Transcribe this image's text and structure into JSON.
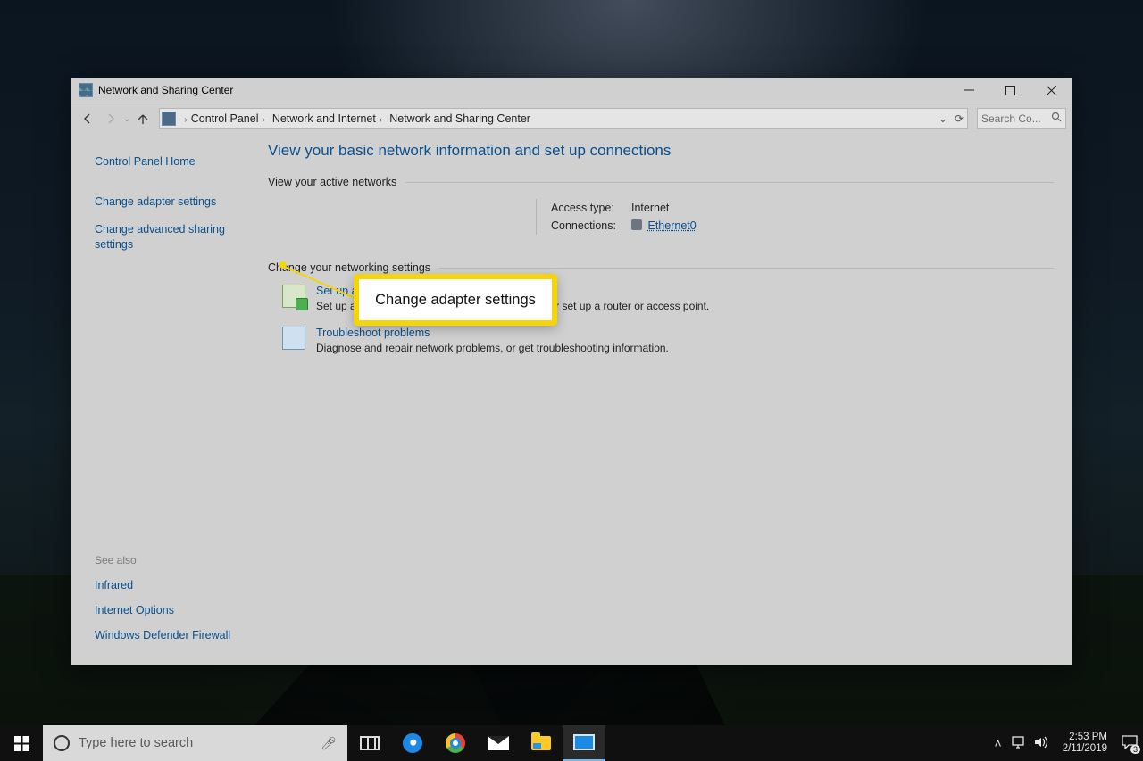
{
  "window": {
    "title": "Network and Sharing Center"
  },
  "breadcrumb": {
    "root": "Control Panel",
    "mid": "Network and Internet",
    "leaf": "Network and Sharing Center"
  },
  "search": {
    "placeholder": "Search Co..."
  },
  "sidebar": {
    "home": "Control Panel Home",
    "adapter": "Change adapter settings",
    "advanced": "Change advanced sharing settings",
    "see_also_hdr": "See also",
    "infrared": "Infrared",
    "internet_options": "Internet Options",
    "firewall": "Windows Defender Firewall"
  },
  "main": {
    "title": "View your basic network information and set up connections",
    "active_hdr": "View your active networks",
    "access_label": "Access type:",
    "access_value": "Internet",
    "conn_label": "Connections:",
    "conn_value": "Ethernet0",
    "change_hdr": "Change your networking settings",
    "opt1_title": "Set up a new connection or network",
    "opt1_desc": "Set up a broadband, dial-up, or VPN connection; or set up a router or access point.",
    "opt2_title": "Troubleshoot problems",
    "opt2_desc": "Diagnose and repair network problems, or get troubleshooting information."
  },
  "callout": {
    "label": "Change adapter settings"
  },
  "taskbar": {
    "search_placeholder": "Type here to search",
    "time": "2:53 PM",
    "date": "2/11/2019",
    "badge": "3"
  }
}
